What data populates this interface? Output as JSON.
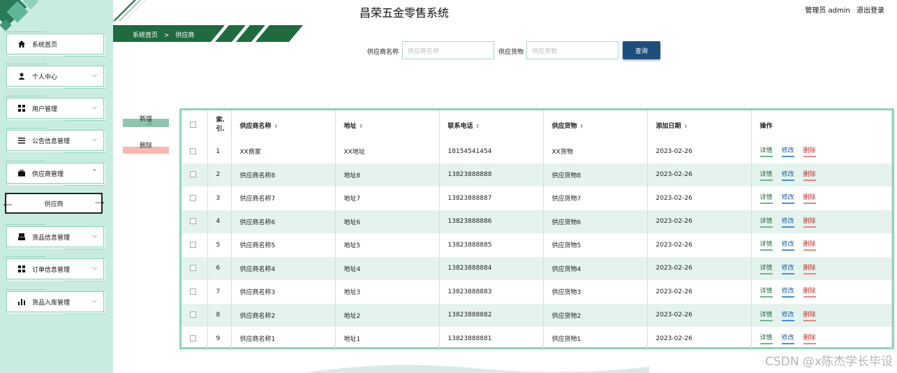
{
  "header": {
    "system_title": "昌荣五金零售系统",
    "user_label": "管理员 admin",
    "logout_label": "退出登录"
  },
  "breadcrumb": {
    "home": "系统首页",
    "separator": ">",
    "current": "供应商"
  },
  "sidebar": {
    "items": [
      {
        "label": "系统首页",
        "icon": "home-icon"
      },
      {
        "label": "个人中心",
        "icon": "user-icon"
      },
      {
        "label": "用户管理",
        "icon": "grid-icon"
      },
      {
        "label": "公告信息管理",
        "icon": "list-icon"
      },
      {
        "label": "供应商管理",
        "icon": "briefcase-icon"
      },
      {
        "label": "货品信息管理",
        "icon": "box-icon"
      },
      {
        "label": "订单信息管理",
        "icon": "grid-icon"
      },
      {
        "label": "货品入库管理",
        "icon": "bar-chart-icon"
      }
    ],
    "sub_item": "供应商"
  },
  "search": {
    "name_label": "供应商名称",
    "name_placeholder": "供应商名称",
    "goods_label": "供应货物",
    "goods_placeholder": "供应货物",
    "query_button": "查询"
  },
  "actions": {
    "add": "新增",
    "delete": "删除"
  },
  "table": {
    "headers": [
      "索引",
      "供应商名称",
      "地址",
      "联系电话",
      "供应货物",
      "添加日期",
      "操作"
    ],
    "index_header_lines": [
      "索.",
      "引."
    ],
    "op_labels": {
      "detail": "详情",
      "edit": "修改",
      "delete": "删除"
    },
    "rows": [
      {
        "index": "1",
        "name": "XX商家",
        "address": "XX地址",
        "phone": "18154541454",
        "goods": "XX货物",
        "date": "2023-02-26"
      },
      {
        "index": "2",
        "name": "供应商名称8",
        "address": "地址8",
        "phone": "13823888888",
        "goods": "供应货物8",
        "date": "2023-02-26"
      },
      {
        "index": "3",
        "name": "供应商名称7",
        "address": "地址7",
        "phone": "13823888887",
        "goods": "供应货物7",
        "date": "2023-02-26"
      },
      {
        "index": "4",
        "name": "供应商名称6",
        "address": "地址6",
        "phone": "13823888886",
        "goods": "供应货物6",
        "date": "2023-02-26"
      },
      {
        "index": "5",
        "name": "供应商名称5",
        "address": "地址5",
        "phone": "13823888885",
        "goods": "供应货物5",
        "date": "2023-02-26"
      },
      {
        "index": "6",
        "name": "供应商名称4",
        "address": "地址4",
        "phone": "13823888884",
        "goods": "供应货物4",
        "date": "2023-02-26"
      },
      {
        "index": "7",
        "name": "供应商名称3",
        "address": "地址3",
        "phone": "13823888883",
        "goods": "供应货物3",
        "date": "2023-02-26"
      },
      {
        "index": "8",
        "name": "供应商名称2",
        "address": "地址2",
        "phone": "13823888882",
        "goods": "供应货物2",
        "date": "2023-02-26"
      },
      {
        "index": "9",
        "name": "供应商名称1",
        "address": "地址1",
        "phone": "13823888881",
        "goods": "供应货物1",
        "date": "2023-02-26"
      }
    ]
  },
  "watermark": "CSDN @x陈杰学长毕设",
  "colors": {
    "accent_green": "#1f6b3d",
    "sidebar_bg": "#c9ece0",
    "query_button": "#1d4f7d",
    "row_alt": "#e4f3ee"
  }
}
